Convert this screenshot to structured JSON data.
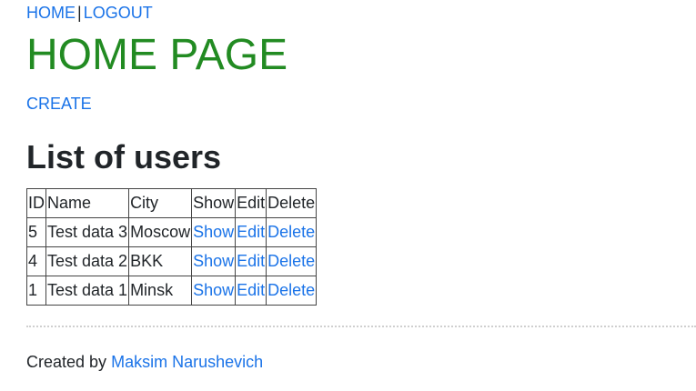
{
  "nav": {
    "home": "HOME",
    "separator": "|",
    "logout": "LOGOUT"
  },
  "page_title": "HOME PAGE",
  "create_link": "CREATE",
  "section_title": "List of users",
  "table": {
    "headers": [
      "ID",
      "Name",
      "City",
      "Show",
      "Edit",
      "Delete"
    ],
    "rows": [
      {
        "id": "5",
        "name": "Test data 3",
        "city": "Moscow",
        "show": "Show",
        "edit": "Edit",
        "delete": "Delete"
      },
      {
        "id": "4",
        "name": "Test data 2",
        "city": "BKK",
        "show": "Show",
        "edit": "Edit",
        "delete": "Delete"
      },
      {
        "id": "1",
        "name": "Test data 1",
        "city": "Minsk",
        "show": "Show",
        "edit": "Edit",
        "delete": "Delete"
      }
    ]
  },
  "footer": {
    "prefix": "Created by",
    "author": "Maksim Narushevich"
  },
  "colors": {
    "title_green": "#228b22",
    "link_blue": "#1a73e8",
    "text": "#212529"
  }
}
